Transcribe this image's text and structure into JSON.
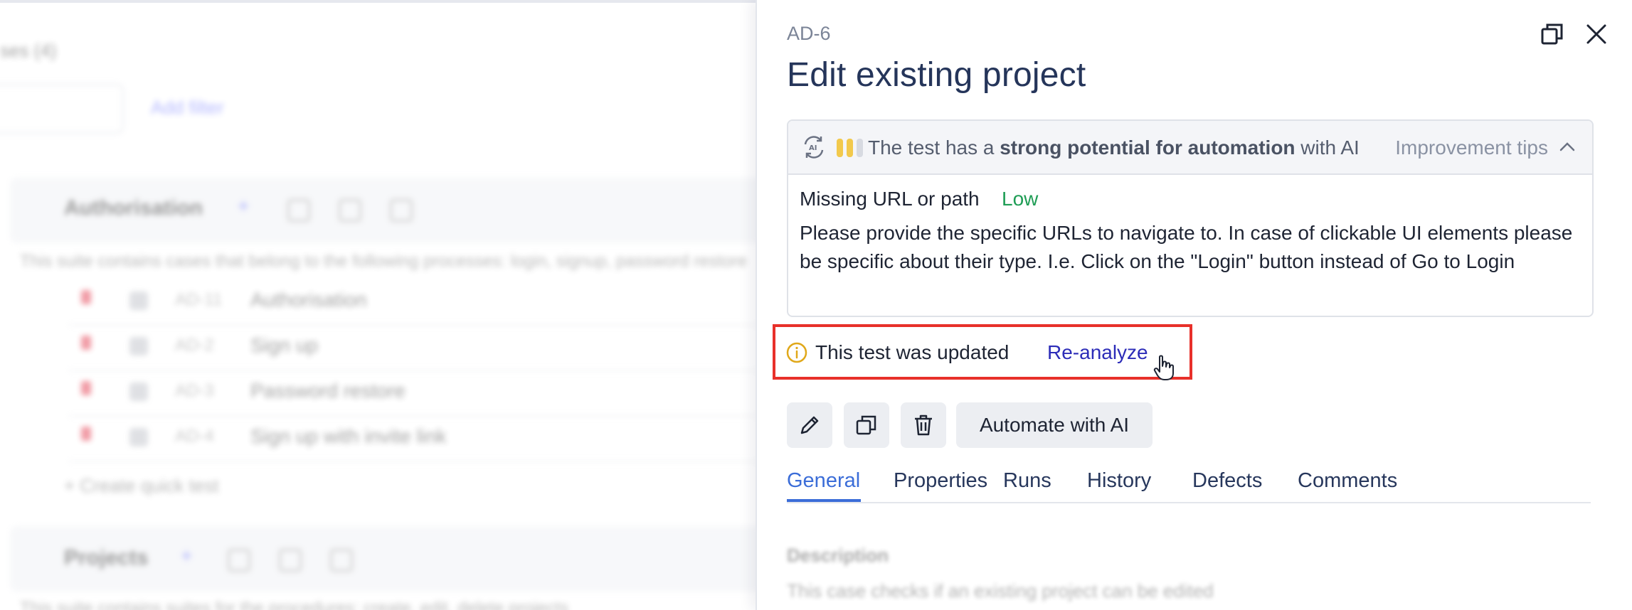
{
  "background": {
    "count_label": "ses (4)",
    "add_filter_label": "Add filter",
    "suites": [
      {
        "title": "Authorisation",
        "description": "This suite contains cases that belong to the following processes: login, signup, password restore",
        "cases": [
          {
            "id": "AD-11",
            "name": "Authorisation"
          },
          {
            "id": "AD-2",
            "name": "Sign up"
          },
          {
            "id": "AD-3",
            "name": "Password restore"
          },
          {
            "id": "AD-4",
            "name": "Sign up with invite link"
          }
        ],
        "quick_test_label": "+ Create quick test"
      },
      {
        "title": "Projects",
        "description": "This suite contains suites for the procedures: create, edit, delete projects"
      }
    ]
  },
  "panel": {
    "test_id": "AD-6",
    "title": "Edit existing project",
    "ai": {
      "text_prefix": "The test has a ",
      "text_bold": "strong potential for automation",
      "text_suffix": " with AI",
      "tips_label": "Improvement tips",
      "bar_colors": [
        "#f2c94c",
        "#f2c94c",
        "#d7dae1"
      ],
      "issue_title": "Missing URL or path",
      "issue_level": "Low",
      "issue_body": "Please provide the specific URLs to navigate to. In case of clickable UI elements please be specific about their type. I.e. Click on the \"Login\" button instead of Go to Login"
    },
    "notice": {
      "text": "This test was updated",
      "action": "Re-analyze"
    },
    "toolbar": {
      "automate_label": "Automate with AI"
    },
    "tabs": [
      "General",
      "Properties",
      "Runs",
      "History",
      "Defects",
      "Comments"
    ],
    "description": {
      "label": "Description",
      "value": "This case checks if an existing project can be edited"
    }
  }
}
